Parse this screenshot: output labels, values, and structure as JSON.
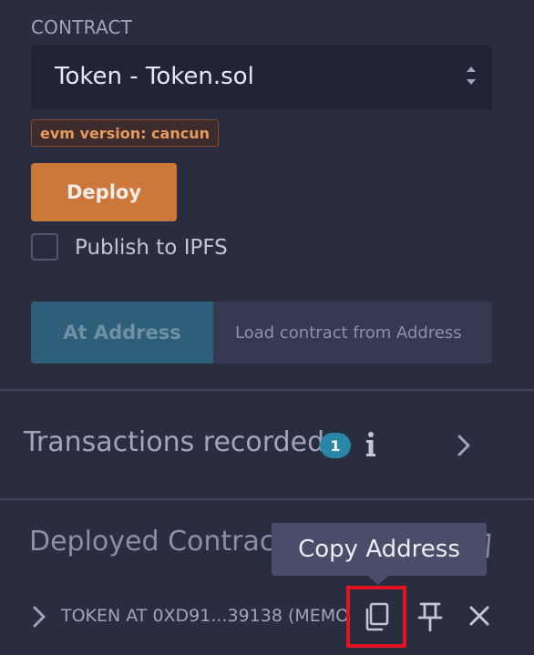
{
  "contract": {
    "section_label": "CONTRACT",
    "selected": "Token - Token.sol",
    "evm_badge": "evm version: cancun"
  },
  "deploy": {
    "button_label": "Deploy",
    "publish_label": "Publish to IPFS",
    "publish_checked": false
  },
  "at_address": {
    "button_label": "At Address",
    "placeholder": "Load contract from Address"
  },
  "transactions": {
    "title": "Transactions recorded",
    "count": "1"
  },
  "deployed": {
    "title": "Deployed Contracts",
    "tooltip": "Copy Address",
    "instance_label": "TOKEN AT 0XD91...39138 (MEMORY)"
  },
  "colors": {
    "background": "#2a2c3f",
    "deploy_accent": "#cc783c",
    "at_address_accent": "#2d5f7a",
    "badge_blue": "#2a86a6",
    "highlight_red": "#e3131f"
  },
  "icons": {
    "select_arrows": "up-down-chevrons-icon",
    "info": "info-icon",
    "expand": "chevron-right-icon",
    "copy": "copy-icon",
    "pin": "pin-icon",
    "close": "close-icon"
  }
}
